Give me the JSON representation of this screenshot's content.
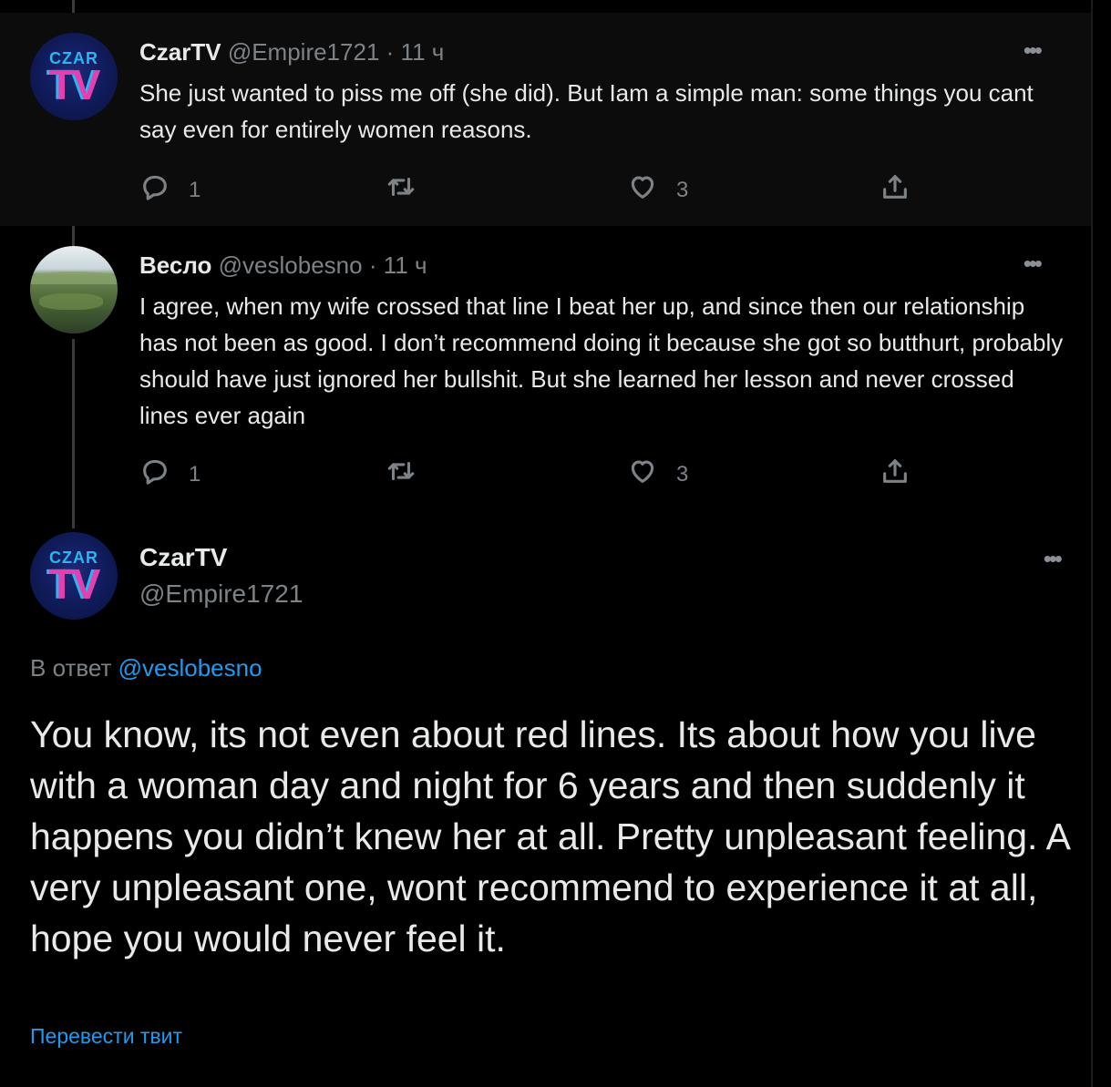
{
  "tweets": [
    {
      "name": "CzarTV",
      "handle": "@Empire1721",
      "sep": "·",
      "time": "11 ч",
      "avatar_top": "CZAR",
      "avatar_bottom": "TV",
      "text": "She just wanted to piss me off (she did). But Iam a simple man: some things you cant say even for entirely women reasons.",
      "replies": "1",
      "retweets": "",
      "likes": "3"
    },
    {
      "name": "Весло",
      "handle": "@veslobesno",
      "sep": "·",
      "time": "11 ч",
      "text": "I agree, when my wife crossed that line I beat her up, and since then our relationship has not been as good. I don’t recommend doing it because she got so butthurt, probably should have just ignored her bullshit. But she learned her lesson and never crossed lines ever again",
      "replies": "1",
      "retweets": "",
      "likes": "3"
    }
  ],
  "main": {
    "name": "CzarTV",
    "handle": "@Empire1721",
    "avatar_top": "CZAR",
    "avatar_bottom": "TV",
    "reply_prefix": "В ответ",
    "reply_to": "@veslobesno",
    "text": "You know, its not even about red lines. Its about how you live with a woman day and night for 6 years and then suddenly it happens you didn’t knew her at all. Pretty unpleasant feeling. A very unpleasant one, wont recommend to experience it at all, hope you would never feel it.",
    "translate": "Перевести твит"
  },
  "icons": {
    "more": "more-dots-icon",
    "reply": "reply-bubble-icon",
    "retweet": "retweet-icon",
    "like": "heart-icon",
    "share": "share-upload-icon"
  },
  "colors": {
    "background": "#000000",
    "highlight_background": "#0c0c0c",
    "link": "#1d9bf0",
    "secondary_text": "#7d8287",
    "primary_text": "#e7e9ea"
  }
}
